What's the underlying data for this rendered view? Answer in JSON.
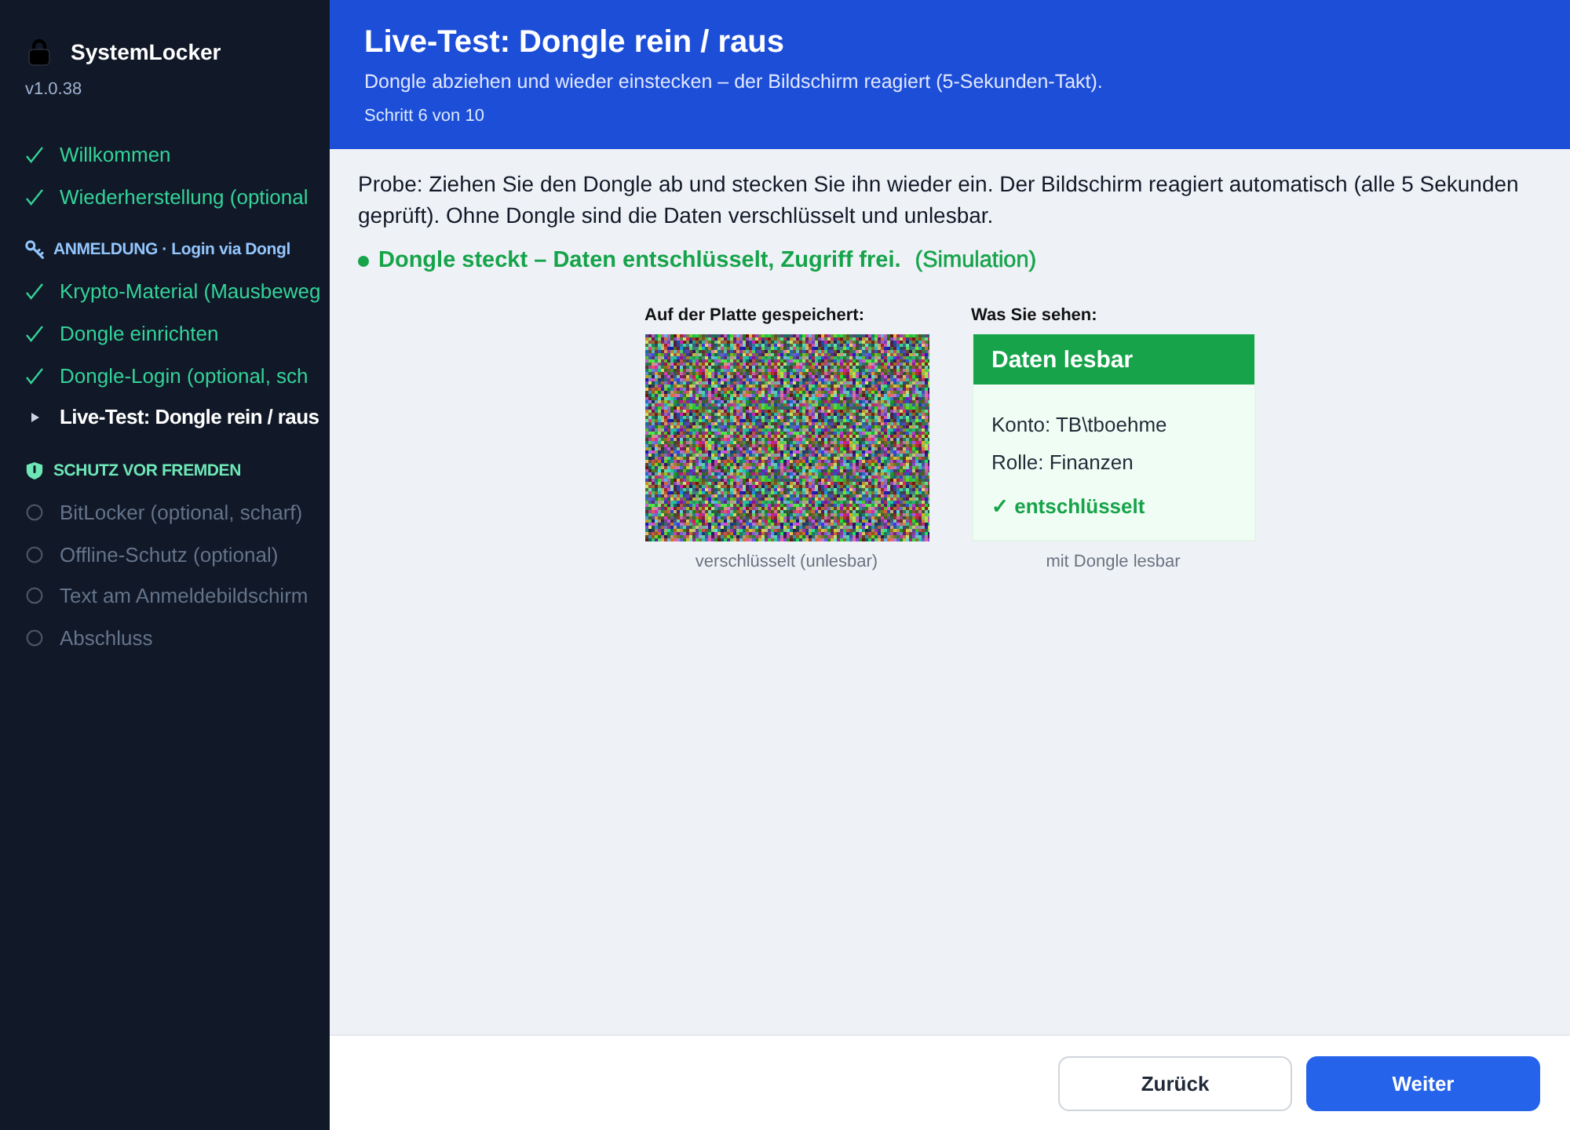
{
  "sidebar": {
    "app_name": "SystemLocker",
    "version": "v1.0.38",
    "nav": [
      {
        "kind": "step",
        "label": "Willkommen",
        "done": true,
        "selected": false
      },
      {
        "kind": "step",
        "label": "Wiederherstellung (optional",
        "done": true,
        "selected": false
      },
      {
        "kind": "section",
        "label": "ANMELDUNG · Login via Dongl",
        "color": "#93c5fd"
      },
      {
        "kind": "step",
        "label": "Krypto-Material (Mausbeweg",
        "done": true,
        "selected": false
      },
      {
        "kind": "step",
        "label": "Dongle einrichten",
        "done": true,
        "selected": false
      },
      {
        "kind": "step",
        "label": "Dongle-Login (optional, sch",
        "done": true,
        "selected": false
      },
      {
        "kind": "step",
        "label": "Live-Test: Dongle rein / raus",
        "done": false,
        "selected": true
      },
      {
        "kind": "section",
        "label": "SCHUTZ VOR FREMDEN",
        "color": "#6ee7b7"
      },
      {
        "kind": "step",
        "label": "BitLocker (optional, scharf)",
        "done": false,
        "selected": false
      },
      {
        "kind": "step",
        "label": "Offline-Schutz (optional)",
        "done": false,
        "selected": false
      },
      {
        "kind": "step",
        "label": "Text am Anmeldebildschirm",
        "done": false,
        "selected": false
      },
      {
        "kind": "step",
        "label": "Abschluss",
        "done": false,
        "selected": false
      }
    ]
  },
  "header": {
    "title": "Live-Test: Dongle rein / raus",
    "subtitle": "Dongle abziehen und wieder einstecken – der Bildschirm reagiert (5-Sekunden-Takt).",
    "step": "Schritt 6 von 10"
  },
  "content": {
    "instructions": "Probe: Ziehen Sie den Dongle ab und stecken Sie ihn wieder ein. Der Bildschirm reagiert automatisch (alle 5 Sekunden geprüft). Ohne Dongle sind die Daten verschlüsselt und unlesbar.",
    "status": {
      "connected": true,
      "text": "Dongle steckt – Daten entschlüsselt, Zugriff frei.",
      "note": "(Simulation)"
    },
    "stored": {
      "label": "Auf der Platte gespeichert:",
      "caption": "verschlüsselt (unlesbar)"
    },
    "view": {
      "label": "Was Sie sehen:",
      "title": "Daten lesbar",
      "lines": [
        "Konto: TB\\tboehme",
        "Rolle: Finanzen"
      ],
      "result": "✓ entschlüsselt",
      "caption": "mit Dongle lesbar"
    }
  },
  "footer": {
    "buttons": [
      {
        "label": "Zurück",
        "kind": "secondary"
      },
      {
        "label": "Weiter",
        "kind": "primary"
      }
    ]
  }
}
